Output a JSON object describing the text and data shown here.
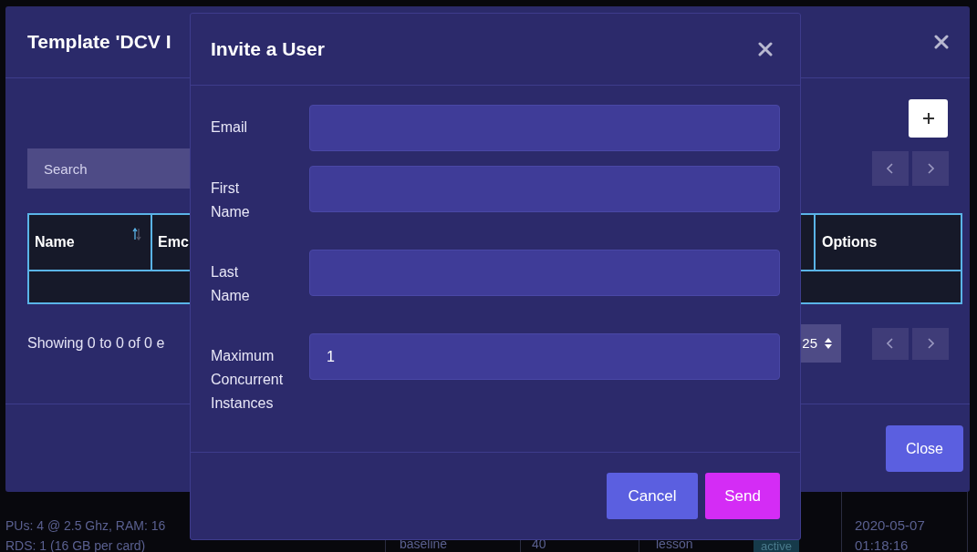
{
  "background_modal": {
    "title": "Template 'DCV I",
    "search": {
      "placeholder": "Search"
    },
    "table": {
      "columns": [
        "Name",
        "Emc",
        "Options"
      ]
    },
    "footer_text": "Showing 0 to 0 of 0 e",
    "page_size": "25",
    "close_button": "Close"
  },
  "background_table_row": {
    "spec_lines": [
      "PUs: 4 @ 2.5 Ghz, RAM: 16",
      "RDS: 1 (16 GB per card)"
    ],
    "column_2": "baseline",
    "column_3": "40",
    "column_4": "lesson",
    "status": "active",
    "date_lines": [
      "2020-05-07",
      "01:18:16"
    ]
  },
  "dialog": {
    "title": "Invite a User",
    "fields": [
      {
        "label": "Email"
      },
      {
        "label": "First Name"
      },
      {
        "label": "Last Name"
      },
      {
        "label": "Maximum Concurrent Instances",
        "value": "1"
      }
    ],
    "buttons": [
      {
        "label": "Cancel",
        "kind": "secondary"
      },
      {
        "label": "Send",
        "kind": "primary"
      }
    ]
  }
}
